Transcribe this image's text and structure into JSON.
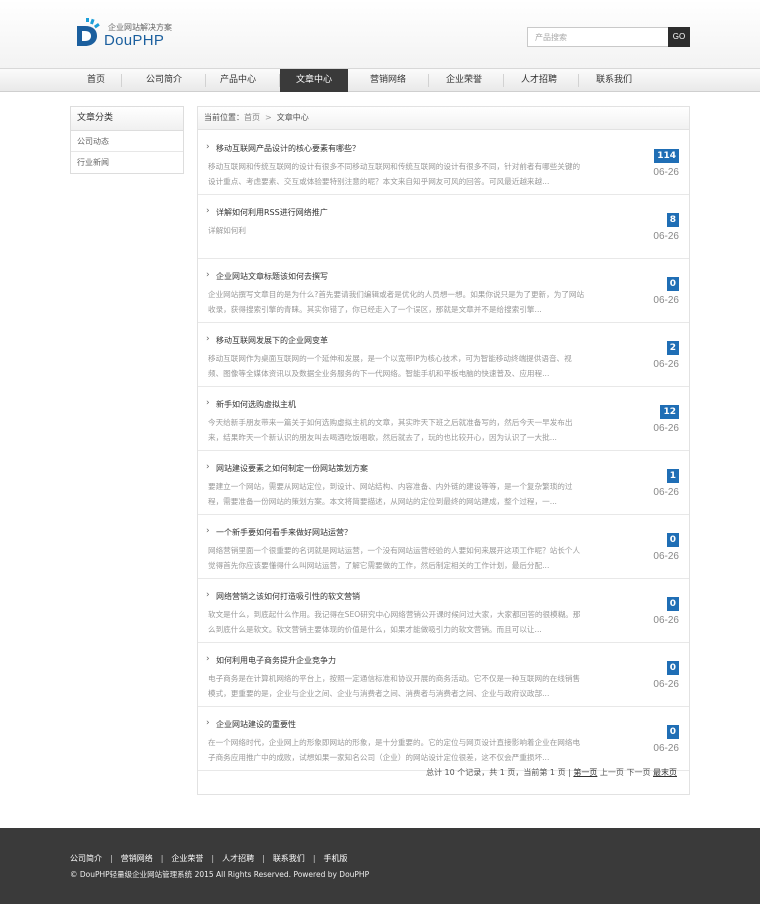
{
  "brand": {
    "subtitle": "企业网站解决方案",
    "name": "DouPHP",
    "colors": {
      "brand": "#1b5f9e",
      "accent": "#1f6eb5",
      "nav_active": "#3a3a3a",
      "footer": "#3a3a3a"
    }
  },
  "search": {
    "placeholder": "产品搜索",
    "button_label": "GO"
  },
  "nav": [
    {
      "label": "首页",
      "active": false
    },
    {
      "label": "公司简介",
      "active": false
    },
    {
      "label": "产品中心",
      "active": false
    },
    {
      "label": "文章中心",
      "active": true
    },
    {
      "label": "营销网络",
      "active": false
    },
    {
      "label": "企业荣誉",
      "active": false
    },
    {
      "label": "人才招聘",
      "active": false
    },
    {
      "label": "联系我们",
      "active": false
    }
  ],
  "sidebar": {
    "title": "文章分类",
    "items": [
      {
        "label": "公司动态"
      },
      {
        "label": "行业新闻"
      }
    ]
  },
  "breadcrumb": {
    "prefix": "当前位置：",
    "home": "首页",
    "separator": ">",
    "current": "文章中心"
  },
  "articles": [
    {
      "title": "移动互联网产品设计的核心要素有哪些？",
      "desc": "移动互联网和传统互联网的设计有很多不同移动互联网和传统互联网的设计有很多不同，针对前者有哪些关键的设计重点、考虑要素、交互或体验要特别注意的呢？本文来自知乎网友可风的回答。可风最近越来越...",
      "count": "114",
      "date": "06-26"
    },
    {
      "title": "详解如何利用RSS进行网络推广",
      "desc": "详解如何利",
      "count": "8",
      "date": "06-26"
    },
    {
      "title": "企业网站文章标题该如何去撰写",
      "desc": "企业网站撰写文章目的是为什么?首先要请我们编辑或者是优化的人员想一想。如果你说只是为了更新，为了网站收录，获得搜索引擎的青睐。其实你错了，你已经走入了一个误区，那就是文章并不是给搜索引擎...",
      "count": "0",
      "date": "06-26"
    },
    {
      "title": "移动互联网发展下的企业网变革",
      "desc": "移动互联网作为桌面互联网的一个延伸和发展，是一个以宽带IP为核心技术，可为智能移动终端提供语音、视频、图像等全媒体资讯以及数据全业务服务的下一代网络。智能手机和平板电脑的快速普及、应用程...",
      "count": "2",
      "date": "06-26"
    },
    {
      "title": "新手如何选购虚拟主机",
      "desc": "今天给新手朋友带来一篇关于如何选购虚拟主机的文章，其实昨天下班之后就准备写的，然后今天一早发布出来，结果昨天一个新认识的朋友叫去喝酒吃饭唱歌，然后就去了，玩的也比较开心，因为认识了一大批...",
      "count": "12",
      "date": "06-26"
    },
    {
      "title": "网站建设要素之如何制定一份网站策划方案",
      "desc": "要建立一个网站，需要从网站定位，到设计、网站结构、内容准备、内外链的建设等等，是一个复杂繁琐的过程，需要准备一份网站的策划方案。本文将简要描述，从网站的定位到最终的网站建成，整个过程，一...",
      "count": "1",
      "date": "06-26"
    },
    {
      "title": "一个新手要如何看手来做好网站运营？",
      "desc": "网络营销里面一个很重要的名词就是网站运营，一个没有网站运营经验的人要如何来展开这项工作呢？站长个人觉得首先你应该要懂得什么叫网站运营，了解它需要做的工作，然后制定相关的工作计划，最后分配...",
      "count": "0",
      "date": "06-26"
    },
    {
      "title": "网络营销之该如何打造吸引性的软文营销",
      "desc": "软文是什么，到底起什么作用。我记得在SEO研究中心网络营销公开课时候问过大家，大家都回答的很模糊。那么到底什么是软文。软文营销主要体现的价值是什么，如果才能做吸引力的软文营销。而且可以让...",
      "count": "0",
      "date": "06-26"
    },
    {
      "title": "如何利用电子商务提升企业竞争力",
      "desc": "电子商务是在计算机网络的平台上，按照一定通信标准和协议开展的商务活动。它不仅是一种互联网的在线销售模式，更重要的是，企业与企业之间、企业与消费者之间、消费者与消费者之间、企业与政府议政部...",
      "count": "0",
      "date": "06-26"
    },
    {
      "title": "企业网站建设的重要性",
      "desc": "在一个网络时代，企业网上的形象即网站的形象，是十分重要的。它的定位与网页设计直接影响着企业在网络电子商务应用推广中的成败，试想如果一家知名公司（企业）的网站设计定位很差，这不仅会严重损坏...",
      "count": "0",
      "date": "06-26"
    }
  ],
  "pager": {
    "summary": "总计 10 个记录，共 1 页，当前第 1 页 |",
    "first": "第一页",
    "prev": "上一页",
    "next": "下一页",
    "last": "最末页"
  },
  "footer": {
    "links": [
      "公司简介",
      "营销网络",
      "企业荣誉",
      "人才招聘",
      "联系我们",
      "手机版"
    ],
    "copyright": "© DouPHP轻量级企业网站管理系统 2015 All Rights Reserved. Powered by DouPHP"
  }
}
